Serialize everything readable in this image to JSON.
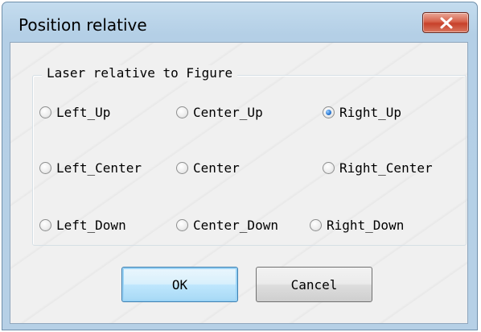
{
  "window": {
    "title": "Position relative"
  },
  "group": {
    "title": "Laser relative to Figure",
    "options": [
      {
        "label": "Left_Up",
        "checked": false
      },
      {
        "label": "Center_Up",
        "checked": false
      },
      {
        "label": "Right_Up",
        "checked": true
      },
      {
        "label": "Left_Center",
        "checked": false
      },
      {
        "label": "Center",
        "checked": false
      },
      {
        "label": "Right_Center",
        "checked": false
      },
      {
        "label": "Left_Down",
        "checked": false
      },
      {
        "label": "Center_Down",
        "checked": false
      },
      {
        "label": "Right_Down",
        "checked": false
      }
    ],
    "selected": "Right_Up"
  },
  "buttons": {
    "ok_label": "OK",
    "cancel_label": "Cancel"
  },
  "colors": {
    "titlebar": "#b6d0e6",
    "client_bg": "#f0f0f0",
    "close_button": "#c7402a",
    "radio_selected": "#2e7cd6"
  }
}
